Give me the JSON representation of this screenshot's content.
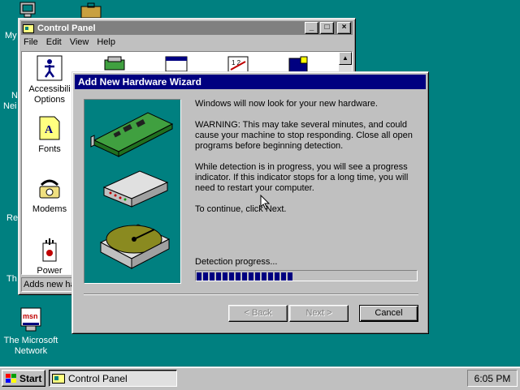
{
  "desktop": {
    "icons": [
      {
        "label": "My",
        "icon": "my-computer-icon"
      },
      {
        "label": "N",
        "icon": "network-icon"
      },
      {
        "label": "Neighborhood fragment",
        "icon": "neighborhood-icon",
        "short": "Nei"
      },
      {
        "label": "Re",
        "icon": "recycle-bin-icon"
      },
      {
        "label": "Th",
        "icon": "inbox-icon"
      },
      {
        "label": "The Microsoft Network",
        "icon": "msn-icon",
        "line1": "The Microsoft",
        "line2": "Network",
        "logo": "msn"
      }
    ]
  },
  "control_panel": {
    "title": "Control Panel",
    "menu": [
      "File",
      "Edit",
      "View",
      "Help"
    ],
    "items": [
      {
        "label1": "Accessibility",
        "label2": "Options",
        "display1": "Accessibili"
      },
      {
        "label1": "Fonts"
      },
      {
        "label1": "Modems"
      },
      {
        "label1": "Power"
      }
    ],
    "status": "Adds new ha"
  },
  "wizard": {
    "title": "Add New Hardware Wizard",
    "para1": "Windows will now look for your new hardware.",
    "para2": "WARNING: This may take several minutes, and could cause your machine to stop responding. Close all open programs before beginning detection.",
    "para3": "While detection is in progress, you will see a progress indicator. If this indicator stops for a long time, you will need to restart your computer.",
    "para4": "To continue, click Next.",
    "progress_label": "Detection progress...",
    "progress_fraction": 0.43,
    "buttons": {
      "back": "< Back",
      "next": "Next >",
      "cancel": "Cancel"
    }
  },
  "taskbar": {
    "start": "Start",
    "task": "Control Panel",
    "clock": "6:05 PM"
  },
  "colors": {
    "desktop": "#008080",
    "title_active": "#000080",
    "title_inactive": "#808080",
    "face": "#c0c0c0"
  }
}
